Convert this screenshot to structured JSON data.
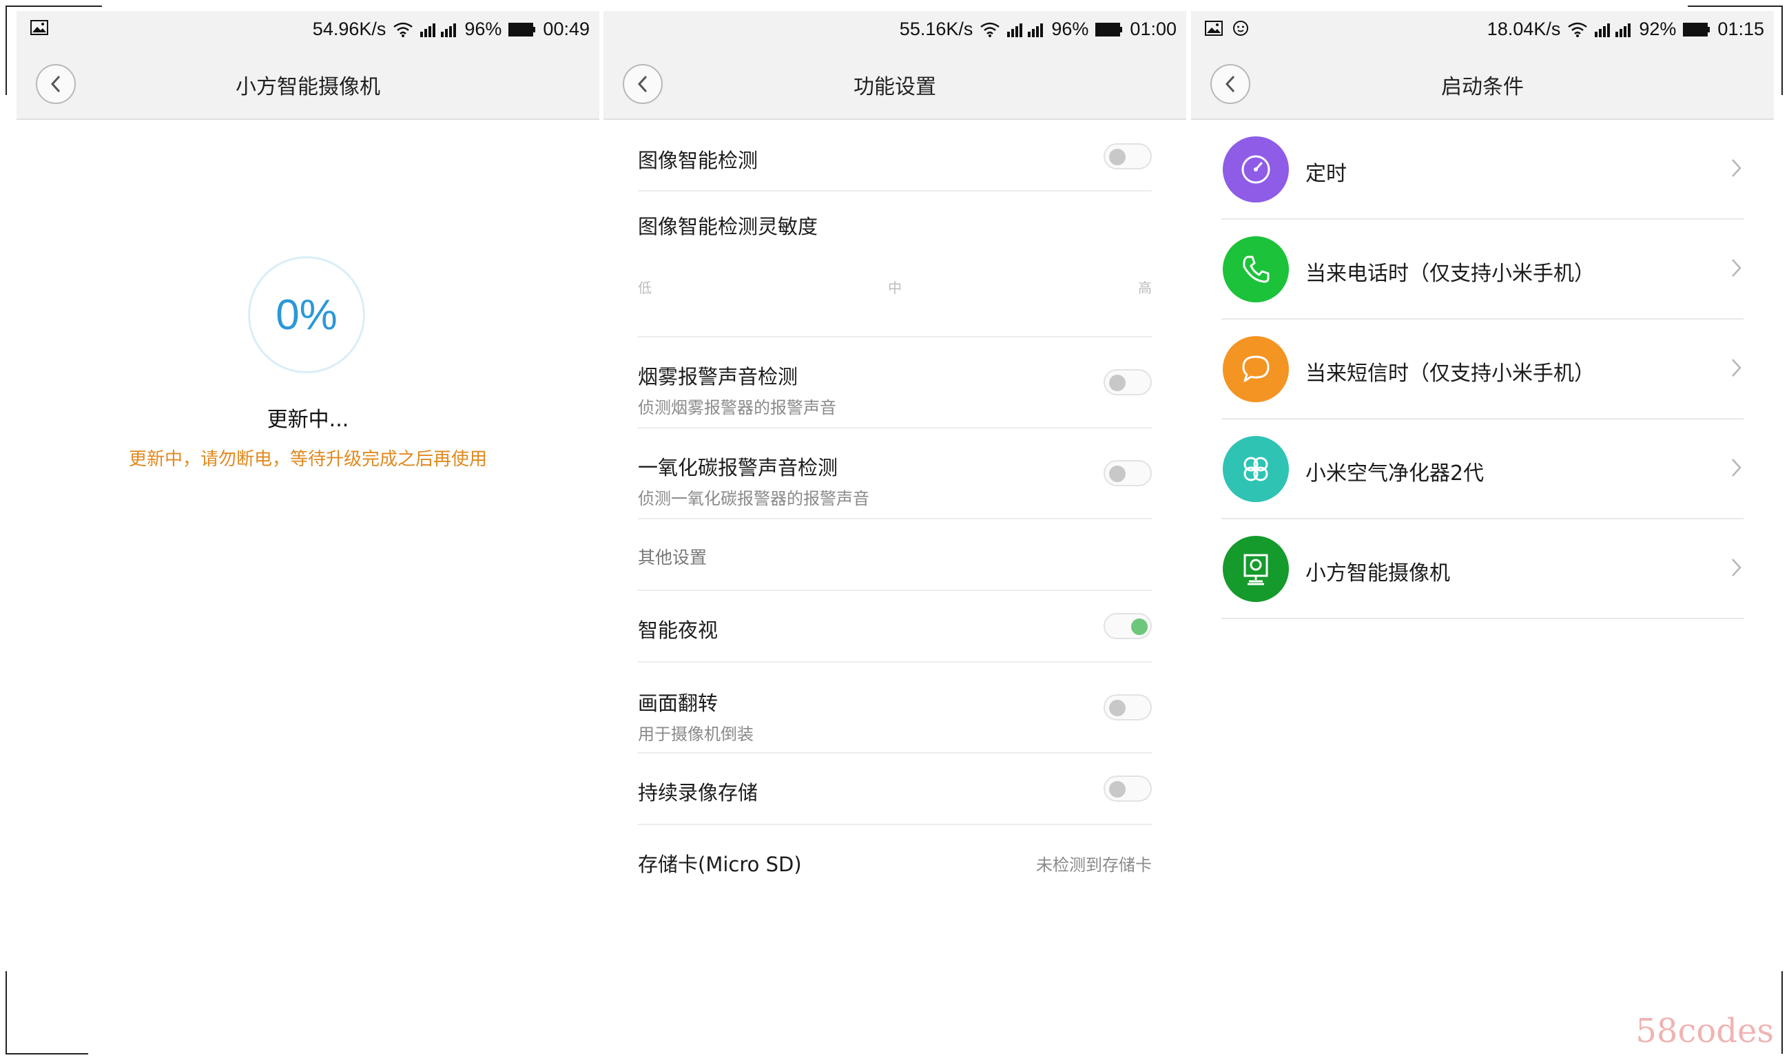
{
  "panel1": {
    "status": {
      "speed": "54.96K/s",
      "battery": "96%",
      "time": "00:49"
    },
    "title": "小方智能摄像机",
    "progress": "0%",
    "updating_title": "更新中...",
    "updating_warning": "更新中，请勿断电，等待升级完成之后再使用"
  },
  "panel2": {
    "status": {
      "speed": "55.16K/s",
      "battery": "96%",
      "time": "01:00"
    },
    "title": "功能设置",
    "image_detect": {
      "label": "图像智能检测",
      "enabled": false
    },
    "sensitivity": {
      "label": "图像智能检测灵敏度",
      "low": "低",
      "mid": "中",
      "high": "高"
    },
    "smoke": {
      "label": "烟雾报警声音检测",
      "desc": "侦测烟雾报警器的报警声音",
      "enabled": false
    },
    "co": {
      "label": "一氧化碳报警声音检测",
      "desc": "侦测一氧化碳报警器的报警声音",
      "enabled": false
    },
    "other_header": "其他设置",
    "night_vision": {
      "label": "智能夜视",
      "enabled": true
    },
    "flip": {
      "label": "画面翻转",
      "desc": "用于摄像机倒装",
      "enabled": false
    },
    "continuous": {
      "label": "持续录像存储",
      "enabled": false
    },
    "sdcard": {
      "label": "存储卡(Micro SD)",
      "value": "未检测到存储卡"
    }
  },
  "panel3": {
    "status": {
      "speed": "18.04K/s",
      "battery": "92%",
      "time": "01:15"
    },
    "title": "启动条件",
    "items": [
      {
        "label": "定时",
        "color": "#8e5ce6",
        "icon": "clock-icon"
      },
      {
        "label": "当来电话时（仅支持小米手机）",
        "color": "#1cc23a",
        "icon": "phone-icon"
      },
      {
        "label": "当来短信时（仅支持小米手机）",
        "color": "#f39423",
        "icon": "message-icon"
      },
      {
        "label": "小米空气净化器2代",
        "color": "#2fc3b4",
        "icon": "fan-icon"
      },
      {
        "label": "小方智能摄像机",
        "color": "#159a2c",
        "icon": "camera-icon"
      }
    ]
  },
  "watermark": "58codes"
}
